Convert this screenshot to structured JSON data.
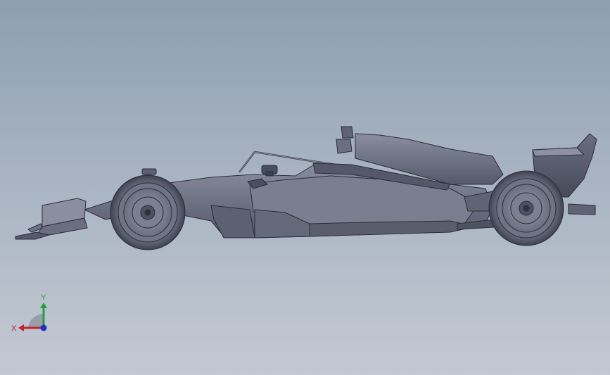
{
  "viewport": {
    "background_top": "#8e9fb1",
    "background_bottom": "#c3c9d3"
  },
  "model": {
    "name": "formula-1-car",
    "body_color": "#6e7284",
    "edge_color": "#2b2d38"
  },
  "triad": {
    "x_label": "X",
    "y_label": "Y",
    "x_color": "#c0262c",
    "y_color": "#22a33a",
    "z_color": "#2030c8"
  }
}
